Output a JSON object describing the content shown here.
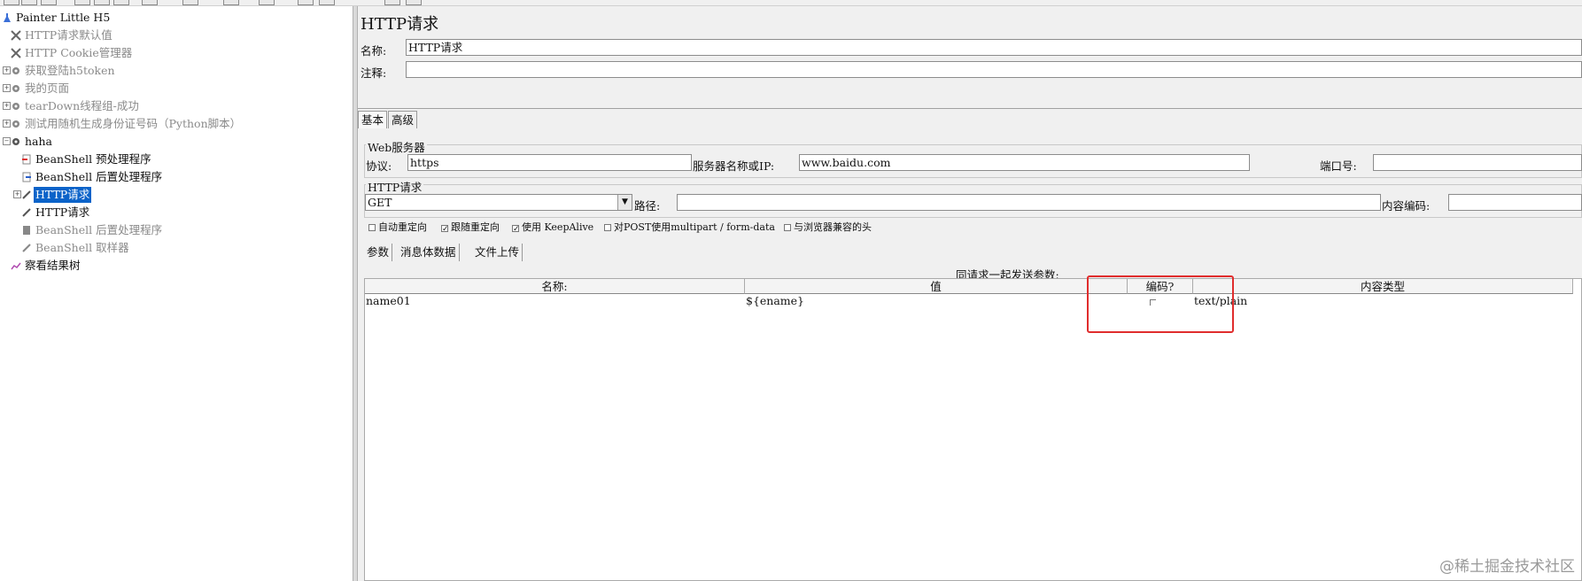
{
  "tree": {
    "root": {
      "label": "Painter Little H5"
    },
    "items": [
      {
        "label": "HTTP请求默认值",
        "disabled": true
      },
      {
        "label": "HTTP Cookie管理器",
        "disabled": true
      },
      {
        "label": "获取登陆h5token",
        "disabled": true
      },
      {
        "label": "我的页面",
        "disabled": true
      },
      {
        "label": "tearDown线程组-成功",
        "disabled": true
      },
      {
        "label": "测试用随机生成身份证号码（Python脚本）",
        "disabled": true
      },
      {
        "label": "haha",
        "disabled": false
      },
      {
        "label": "BeanShell 预处理程序",
        "disabled": false
      },
      {
        "label": "BeanShell 后置处理程序",
        "disabled": false
      },
      {
        "label": "HTTP请求",
        "selected": true
      },
      {
        "label": "HTTP请求",
        "disabled": false
      },
      {
        "label": "BeanShell 后置处理程序",
        "disabled": true
      },
      {
        "label": "BeanShell 取样器",
        "disabled": true
      },
      {
        "label": "察看结果树",
        "disabled": false
      }
    ]
  },
  "panel": {
    "title": "HTTP请求",
    "name_label": "名称:",
    "name_value": "HTTP请求",
    "comment_label": "注释:",
    "comment_value": "",
    "tabs": [
      "基本",
      "高级"
    ],
    "web_server": {
      "group_title": "Web服务器",
      "protocol_label": "协议:",
      "protocol_value": "https",
      "server_label": "服务器名称或IP:",
      "server_value": "www.baidu.com",
      "port_label": "端口号:",
      "port_value": ""
    },
    "http_request": {
      "group_title": "HTTP请求",
      "method": "GET",
      "path_label": "路径:",
      "path_value": "",
      "encoding_label": "内容编码:",
      "encoding_value": ""
    },
    "options": [
      {
        "label": "自动重定向",
        "checked": false
      },
      {
        "label": "跟随重定向",
        "checked": true
      },
      {
        "label": "使用 KeepAlive",
        "checked": true
      },
      {
        "label": "对POST使用multipart / form-data",
        "checked": false
      },
      {
        "label": "与浏览器兼容的头",
        "checked": false
      }
    ],
    "sub_tabs": [
      "参数",
      "消息体数据",
      "文件上传"
    ],
    "params_caption": "同请求一起发送参数:",
    "table": {
      "columns": [
        "名称:",
        "值",
        "编码?",
        "内容类型"
      ],
      "rows": [
        {
          "name": "name01",
          "value": "${ename}",
          "encode": false,
          "content_type": "text/plain"
        }
      ]
    }
  },
  "watermark": "@稀土掘金技术社区",
  "colors": {
    "selection": "#0b63c9",
    "highlight_box": "#e02d2d"
  }
}
